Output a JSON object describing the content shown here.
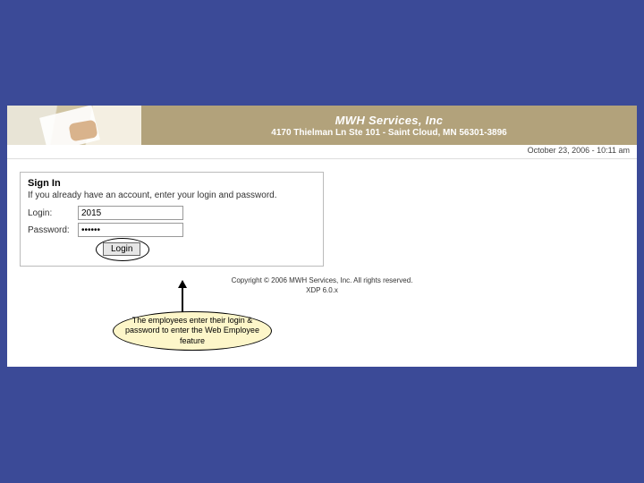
{
  "banner": {
    "company": "MWH Services, Inc",
    "address": "4170 Thielman Ln Ste 101 - Saint Cloud, MN 56301-3896"
  },
  "datebar": "October 23, 2006 - 10:11 am",
  "signin": {
    "heading": "Sign In",
    "subheading": "If you already have an account, enter your login and password.",
    "login_label": "Login:",
    "login_value": "2015",
    "password_label": "Password:",
    "password_value": "••••••",
    "login_button": "Login"
  },
  "footer": {
    "line1": "Copyright © 2006 MWH Services, Inc. All rights reserved.",
    "line2": "XDP 6.0.x"
  },
  "callout": "The employees enter their login & password to enter the Web Employee feature"
}
